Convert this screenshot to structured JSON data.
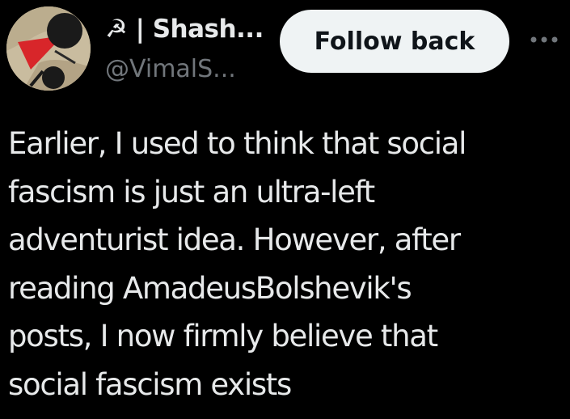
{
  "user": {
    "display_name": "☭ | Shash...",
    "handle": "@VimalS...",
    "avatar_icon": "avatar-image"
  },
  "actions": {
    "follow_label": "Follow back",
    "more_icon": "more-options-icon"
  },
  "tweet": {
    "lines": [
      "Earlier, I used to think that social",
      "fascism is just an ultra-left",
      "adventurist idea. However, after",
      "reading AmadeusBolshevik's",
      "posts, I now firmly believe that",
      "social fascism exists"
    ]
  },
  "colors": {
    "background": "#000000",
    "text_primary": "#e7e9ea",
    "text_secondary": "#71767b",
    "button_bg": "#eff3f4",
    "button_text": "#0f1419"
  }
}
